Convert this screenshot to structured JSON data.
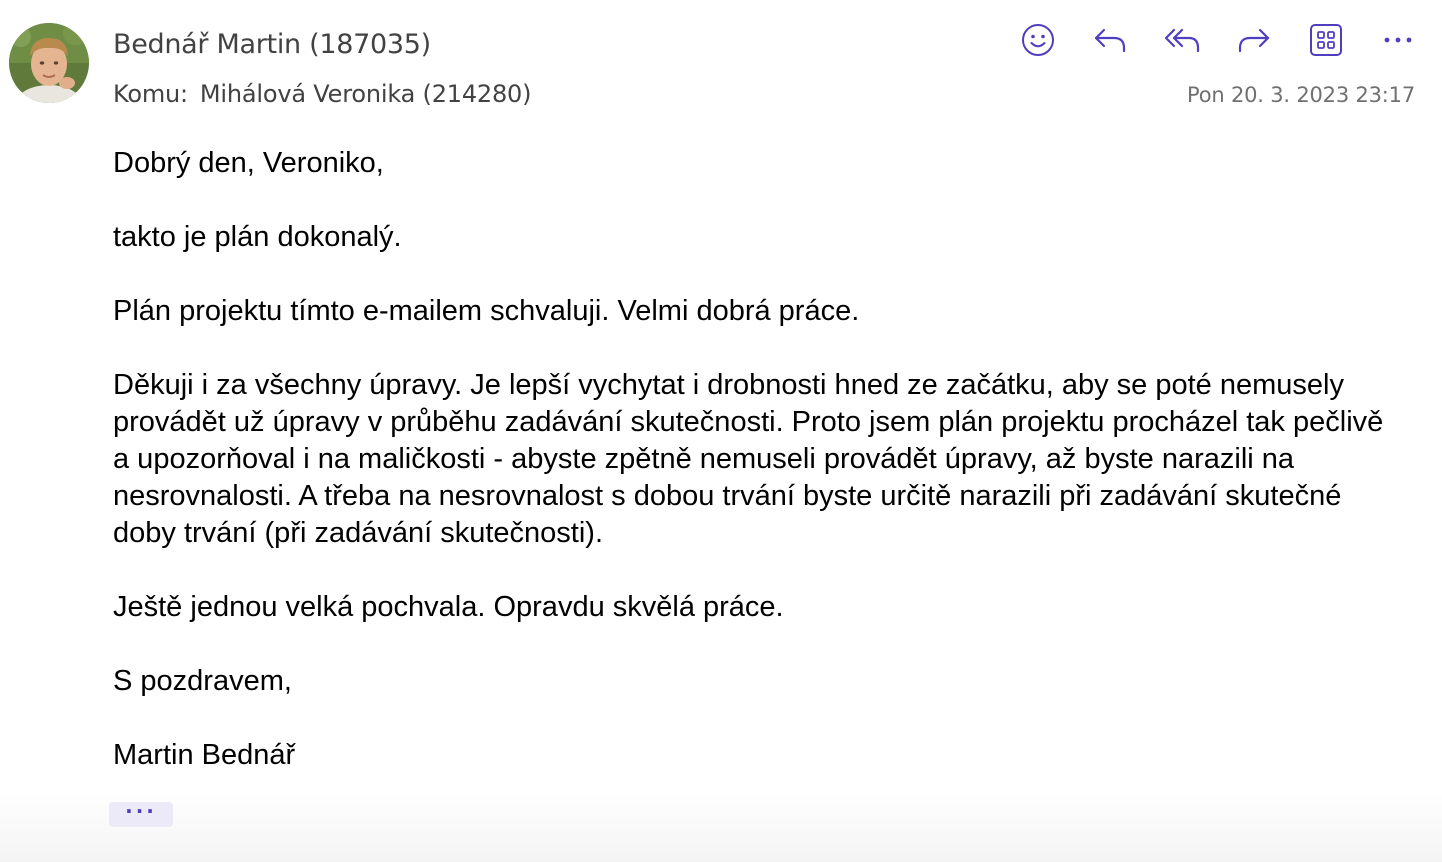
{
  "header": {
    "sender": "Bednář Martin (187035)",
    "to_label": "Komu:",
    "recipient": "Mihálová Veronika (214280)",
    "timestamp": "Pon 20. 3. 2023 23:17"
  },
  "toolbar": {
    "icons": [
      "smiley-icon",
      "reply-icon",
      "reply-all-icon",
      "forward-icon",
      "apps-icon",
      "more-icon"
    ],
    "accent_color": "#4f3fbf"
  },
  "message": {
    "paragraphs": [
      "Dobrý den, Veroniko,",
      "takto je plán dokonalý.",
      "Plán projektu tímto e-mailem schvaluji. Velmi dobrá práce.",
      "Děkuji i za všechny úpravy. Je lepší vychytat i drobnosti hned ze začátku, aby se poté nemusely provádět už úpravy v průběhu zadávání skutečnosti. Proto jsem plán projektu procházel tak pečlivě a upozorňoval i na maličkosti - abyste zpětně nemuseli provádět úpravy, až byste narazili na nesrovnalosti. A třeba na nesrovnalost s dobou trvání byste určitě narazili při zadávání skutečné doby trvání (při zadávání skutečnosti).",
      "Ještě jednou velká pochvala. Opravdu skvělá práce.",
      "S pozdravem,",
      "Martin Bednář"
    ]
  },
  "expand_label": "···"
}
